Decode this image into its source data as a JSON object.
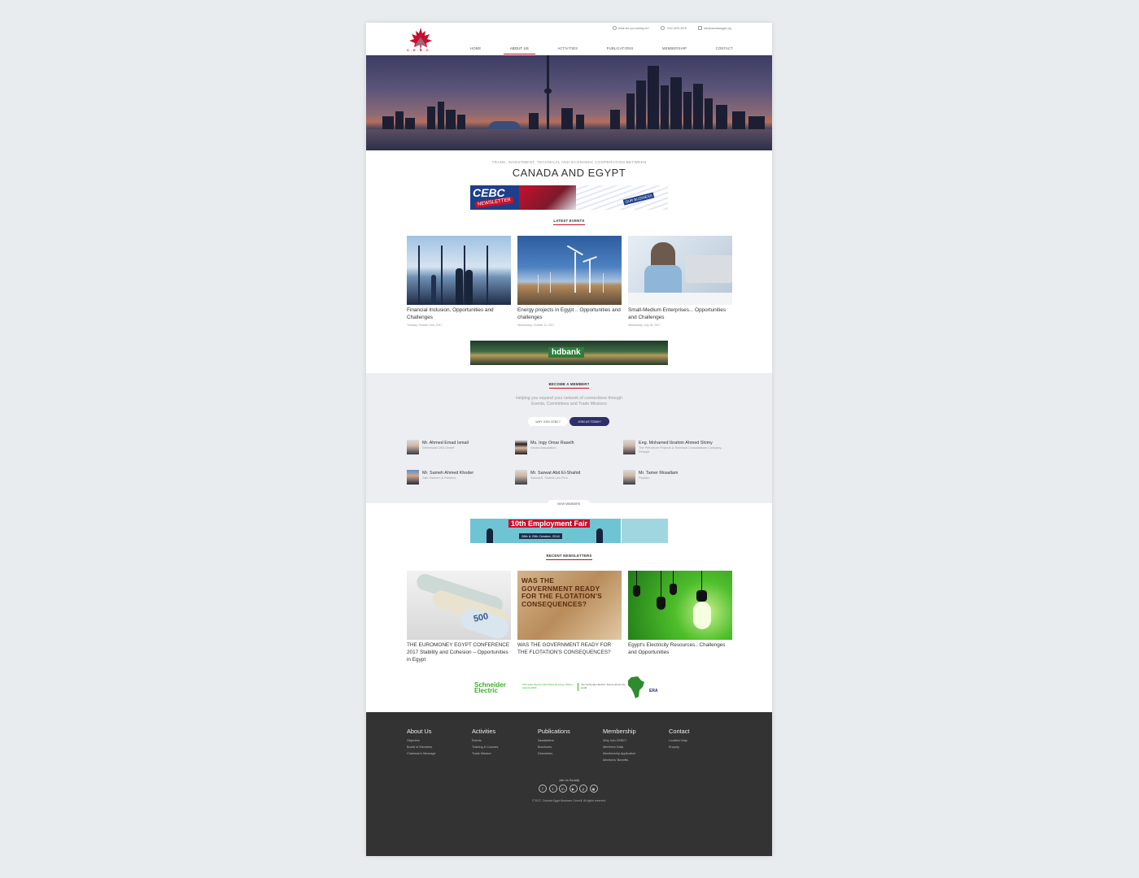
{
  "brand": {
    "logo_text": "C.E.B.C"
  },
  "topbar": {
    "search_placeholder": "What are you looking for?",
    "phone": "+202 3291 4976",
    "email": "info@canadaegypt.org"
  },
  "nav": [
    "HOME",
    "ABOUT US",
    "ACTIVITIES",
    "PUBLICATIONS",
    "MEMBERSHIP",
    "CONTACT"
  ],
  "tagline": {
    "small": "TRADE, INVESTMENT, TECHNICAL AND ECONOMIC COOPERATION BETWEEN",
    "big": "CANADA AND EGYPT"
  },
  "newsletter_banner": {
    "text_left": "CEBC",
    "text_mid": "NEWSLETTER",
    "text_right": "OUR BUSINESS"
  },
  "latest_events": {
    "title": "LATEST EVENTS",
    "items": [
      {
        "title": "Financial Inclusion, Opportunities and Challenges",
        "date": "Tuesday, October 31st, 2017"
      },
      {
        "title": "Energy projects in Egypt .. Opportunities and challenges",
        "date": "Wednesday, October 11, 2017"
      },
      {
        "title": "Small-Medium Enterprises... Opportunities and Challenges",
        "date": "Wednesday, July 26, 2017"
      }
    ]
  },
  "bank_banner": {
    "text": "hdbank"
  },
  "membership": {
    "title": "BECOME A MEMBER?",
    "subtitle_1": "Helping you expand your network of connections through",
    "subtitle_2": "Events, Committees and Trade Missions",
    "why_label": "WHY JOIN CEBC?",
    "join_label": "JOIN US TODAY!",
    "view_label": "VIEW MEMBERS",
    "members": [
      {
        "name": "Mr. Ahmed Emad Ismail",
        "company": "Wintershall DEA GmbH"
      },
      {
        "name": "Ms. Ingy Omar Raselh",
        "company": "Gecha Association"
      },
      {
        "name": "Eng. Mohamed Ibrahim Ahmed Shimy",
        "company": "The Petroleum Projects & Technical Consultations Company - Petrojet"
      },
      {
        "name": "Mr. Sameh Ahmed Khoder",
        "company": "Zaki Hashem & Partners"
      },
      {
        "name": "Mr. Sarwat Abd El-Shahid",
        "company": "Sarwat A. Shahid Law Firm"
      },
      {
        "name": "Mr. Tamer Mosallam",
        "company": "Pepsico"
      }
    ]
  },
  "fair_banner": {
    "title": "10th Employment Fair",
    "dates": "28th & 29th October, 2018"
  },
  "newsletters": {
    "title": "RECENT NEWSLETTERS",
    "items": [
      {
        "title": "THE EUROMONEY EGYPT CONFERENCE 2017 Stability and Cohesion – Opportunities in Egypt"
      },
      {
        "title": "WAS THE GOVERNMENT READY FOR THE FLOTATION'S CONSEQUENCES?",
        "image_text": "WAS THE GOVERNMENT READY FOR THE FLOTATION'S CONSEQUENCES?"
      },
      {
        "title": "Egypt's Electricity Resources.. Challenges and Opportunities"
      }
    ]
  },
  "sponsor_logos": {
    "schneider": "Schneider Electric",
    "award": "Schneider Electric Africa Best Employer Brand Awards 2016",
    "join": "Join Schneider Electric Teams across the world",
    "era": "ERA"
  },
  "footer": {
    "columns": [
      {
        "heading": "About Us",
        "links": [
          "Objective",
          "Board of Members",
          "Chairman's Message"
        ]
      },
      {
        "heading": "Activities",
        "links": [
          "Events",
          "Training & Courses",
          "Trade Mission"
        ]
      },
      {
        "heading": "Publications",
        "links": [
          "Newsletters",
          "Brochures",
          "Directories"
        ]
      },
      {
        "heading": "Membership",
        "links": [
          "Why Join CEBC?",
          "Members Data",
          "Membership Application",
          "Members' Benefits"
        ]
      },
      {
        "heading": "Contact",
        "links": [
          "Location Map",
          "Enquiry"
        ]
      }
    ],
    "join_socially": "Join Us Socially",
    "socials": [
      "f",
      "t",
      "in",
      "▶",
      "p",
      "▣"
    ],
    "copyright": "© 2017, Canada Egypt Business Council. All rights reserved."
  },
  "colors": {
    "accent": "#c8102e",
    "button_dark": "#2d2f6b",
    "footer_bg": "#333333",
    "band_bg": "#eceef1"
  }
}
